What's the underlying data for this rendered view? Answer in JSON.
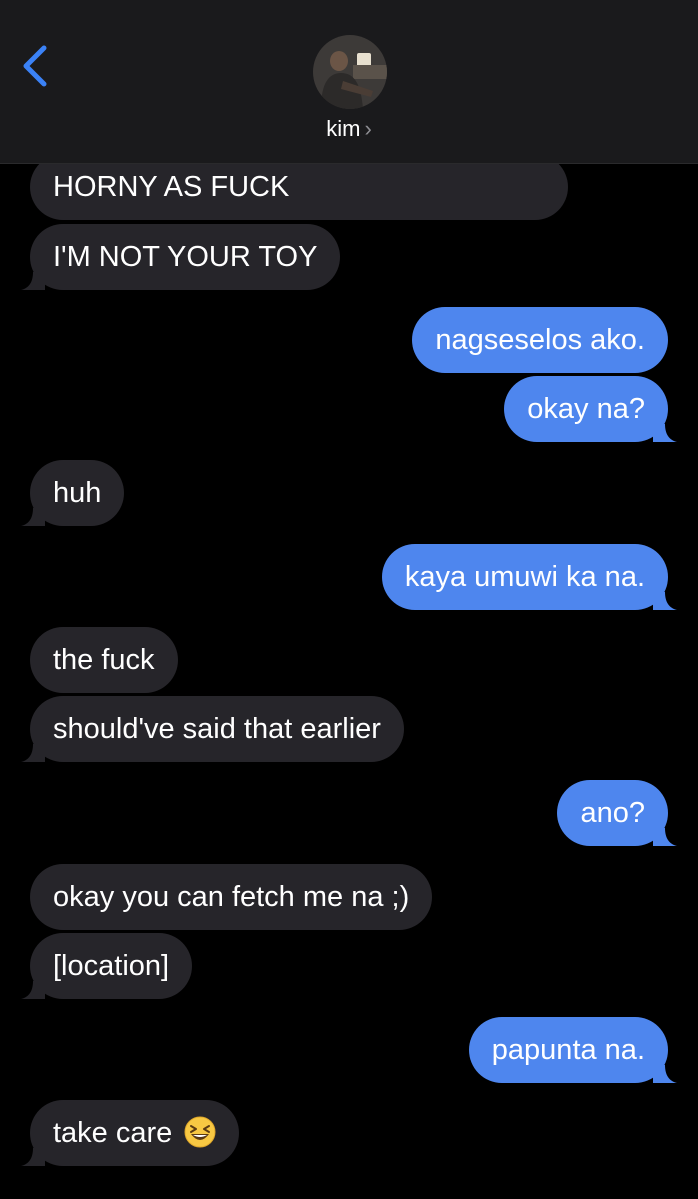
{
  "header": {
    "contact_name": "kim",
    "chevron": "›"
  },
  "messages": [
    {
      "id": "m1",
      "direction": "incoming",
      "text": "HORNY AS FUCK"
    },
    {
      "id": "m2",
      "direction": "incoming",
      "text": "I'M NOT YOUR TOY"
    },
    {
      "id": "m3",
      "direction": "outgoing",
      "text": "nagseselos ako."
    },
    {
      "id": "m4",
      "direction": "outgoing",
      "text": "okay na?"
    },
    {
      "id": "m5",
      "direction": "incoming",
      "text": "huh"
    },
    {
      "id": "m6",
      "direction": "outgoing",
      "text": "kaya umuwi ka na."
    },
    {
      "id": "m7",
      "direction": "incoming",
      "text": "the fuck"
    },
    {
      "id": "m8",
      "direction": "incoming",
      "text": "should've said that earlier"
    },
    {
      "id": "m9",
      "direction": "outgoing",
      "text": "ano?"
    },
    {
      "id": "m10",
      "direction": "incoming",
      "text": "okay you can fetch me na ;)"
    },
    {
      "id": "m11",
      "direction": "incoming",
      "text": "[location]"
    },
    {
      "id": "m12",
      "direction": "outgoing",
      "text": "papunta na."
    },
    {
      "id": "m13",
      "direction": "incoming",
      "text": "take care",
      "emoji": "grinning-squinting-face"
    }
  ],
  "colors": {
    "background": "#000000",
    "header": "#1a1a1c",
    "incoming_bubble": "#26252a",
    "outgoing_bubble": "#4e86ee",
    "back_chevron": "#3b82f6"
  }
}
